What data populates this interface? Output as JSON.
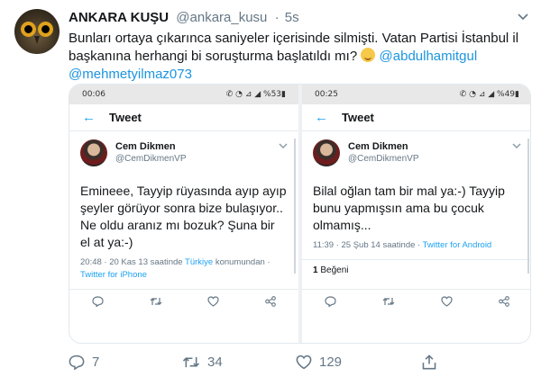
{
  "author": {
    "name": "ANKARA KUŞU",
    "handle": "@ankara_kusu",
    "separator": "·",
    "time": "5s"
  },
  "tweet": {
    "text": "Bunları ortaya çıkarınca saniyeler içerisinde silmişti. Vatan Partisi İstanbul il başkanına herhangi bi soruşturma başlatıldı mı?",
    "mention1": "@abdulhamitgul",
    "mention2": "@mehmetyilmaz073"
  },
  "screenshots": [
    {
      "status_time": "00:06",
      "status_icons": "✆ ◔ ⊿ ◢ %53▮",
      "back_icon": "←",
      "app_title": "Tweet",
      "quoted_name": "Cem Dikmen",
      "quoted_handle": "@CemDikmenVP",
      "body": "Emineee, Tayyip rüyasında ayıp ayıp şeyler görüyor sonra bize bulaşıyor.. Ne oldu aranız mı bozuk? Şuna bir el at ya:-)",
      "info_time": "20:48 · 20 Kas 13 saatinde",
      "info_location": "Türkiye",
      "info_location_suffix": "konumundan ·",
      "info_client": "Twitter for iPhone"
    },
    {
      "status_time": "00:25",
      "status_icons": "✆ ◔ ⊿ ◢ %49▮",
      "back_icon": "←",
      "app_title": "Tweet",
      "quoted_name": "Cem Dikmen",
      "quoted_handle": "@CemDikmenVP",
      "body": "Bilal oğlan tam bir mal ya:-) Tayyip bunu yapmışsın ama bu çocuk olmamış...",
      "info_time": "11:39 · 25 Şub 14 saatinde ·",
      "info_client": "Twitter for Android",
      "likes_count": "1",
      "likes_label": "Beğeni"
    }
  ],
  "footer": {
    "replies": "7",
    "retweets": "34",
    "likes": "129"
  },
  "colors": {
    "accent": "#1da1f2",
    "mention": "#1b95e0",
    "muted": "#657786"
  }
}
